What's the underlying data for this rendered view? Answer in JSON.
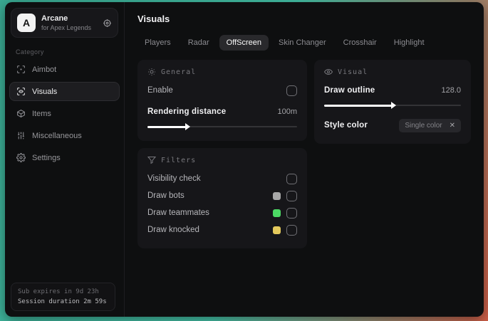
{
  "brand": {
    "logo_letter": "A",
    "name": "Arcane",
    "subtitle": "for Apex Legends"
  },
  "sidebar": {
    "category_label": "Category",
    "items": [
      {
        "label": "Aimbot"
      },
      {
        "label": "Visuals"
      },
      {
        "label": "Items"
      },
      {
        "label": "Miscellaneous"
      },
      {
        "label": "Settings"
      }
    ],
    "session": {
      "line1": "Sub expires in 9d 23h",
      "line2": "Session duration 2m 59s"
    }
  },
  "header": {
    "page_title": "Visuals"
  },
  "tabs": [
    {
      "label": "Players"
    },
    {
      "label": "Radar"
    },
    {
      "label": "OffScreen"
    },
    {
      "label": "Skin Changer"
    },
    {
      "label": "Crosshair"
    },
    {
      "label": "Highlight"
    }
  ],
  "active_tab": "OffScreen",
  "panels": {
    "general": {
      "title": "General",
      "enable_label": "Enable",
      "enable_checked": false,
      "distance_label": "Rendering distance",
      "distance_value": "100m",
      "distance_fill": "26%"
    },
    "visual": {
      "title": "Visual",
      "outline_label": "Draw outline",
      "outline_value": "128.0",
      "outline_fill": "50%",
      "style_label": "Style color",
      "style_value": "Single color",
      "style_remove": "✕"
    },
    "filters": {
      "title": "Filters",
      "rows": [
        {
          "label": "Visibility check",
          "swatch": "",
          "checked": false
        },
        {
          "label": "Draw bots",
          "swatch": "#a8a8a8",
          "checked": false
        },
        {
          "label": "Draw teammates",
          "swatch": "#4cd964",
          "checked": false
        },
        {
          "label": "Draw knocked",
          "swatch": "#e4c95c",
          "checked": false
        }
      ]
    }
  },
  "colors": {
    "accent_teal": "#3aab93",
    "accent_red": "#cf5f48",
    "panel_bg": "#161619",
    "window_bg": "#0e0f10"
  }
}
